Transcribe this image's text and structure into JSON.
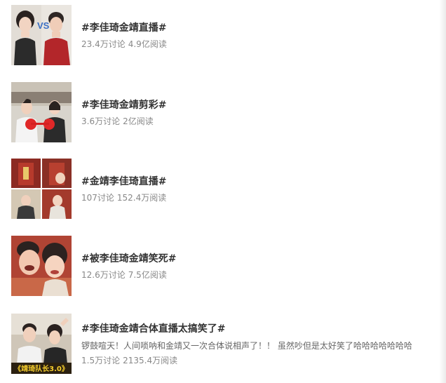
{
  "topics": [
    {
      "title": "#李佳琦金靖直播#",
      "discussions": "23.4万讨论",
      "reads": "4.9亿阅读",
      "thumbnail": "two-people-vs-photo"
    },
    {
      "title": "#李佳琦金靖剪彩#",
      "discussions": "3.6万讨论",
      "reads": "2亿阅读",
      "thumbnail": "ribbon-cutting-photo"
    },
    {
      "title": "#金靖李佳琦直播#",
      "discussions": "107讨论",
      "reads": "152.4万阅读",
      "thumbnail": "four-panel-collage"
    },
    {
      "title": "#被李佳琦金靖笑死#",
      "discussions": "12.6万讨论",
      "reads": "7.5亿阅读",
      "thumbnail": "laughing-selfie-photo"
    },
    {
      "title": "#李佳琦金靖合体直播太搞笑了#",
      "description": "锣鼓喧天！人间唢呐和金靖又一次合体说相声了！！ 虽然吵但是太好笑了哈哈哈哈哈哈哈",
      "discussions": "1.5万讨论",
      "reads": "2135.4万阅读",
      "thumbnail": "livestream-photo",
      "thumbnail_caption": "《靖琦队长3.0》"
    }
  ]
}
